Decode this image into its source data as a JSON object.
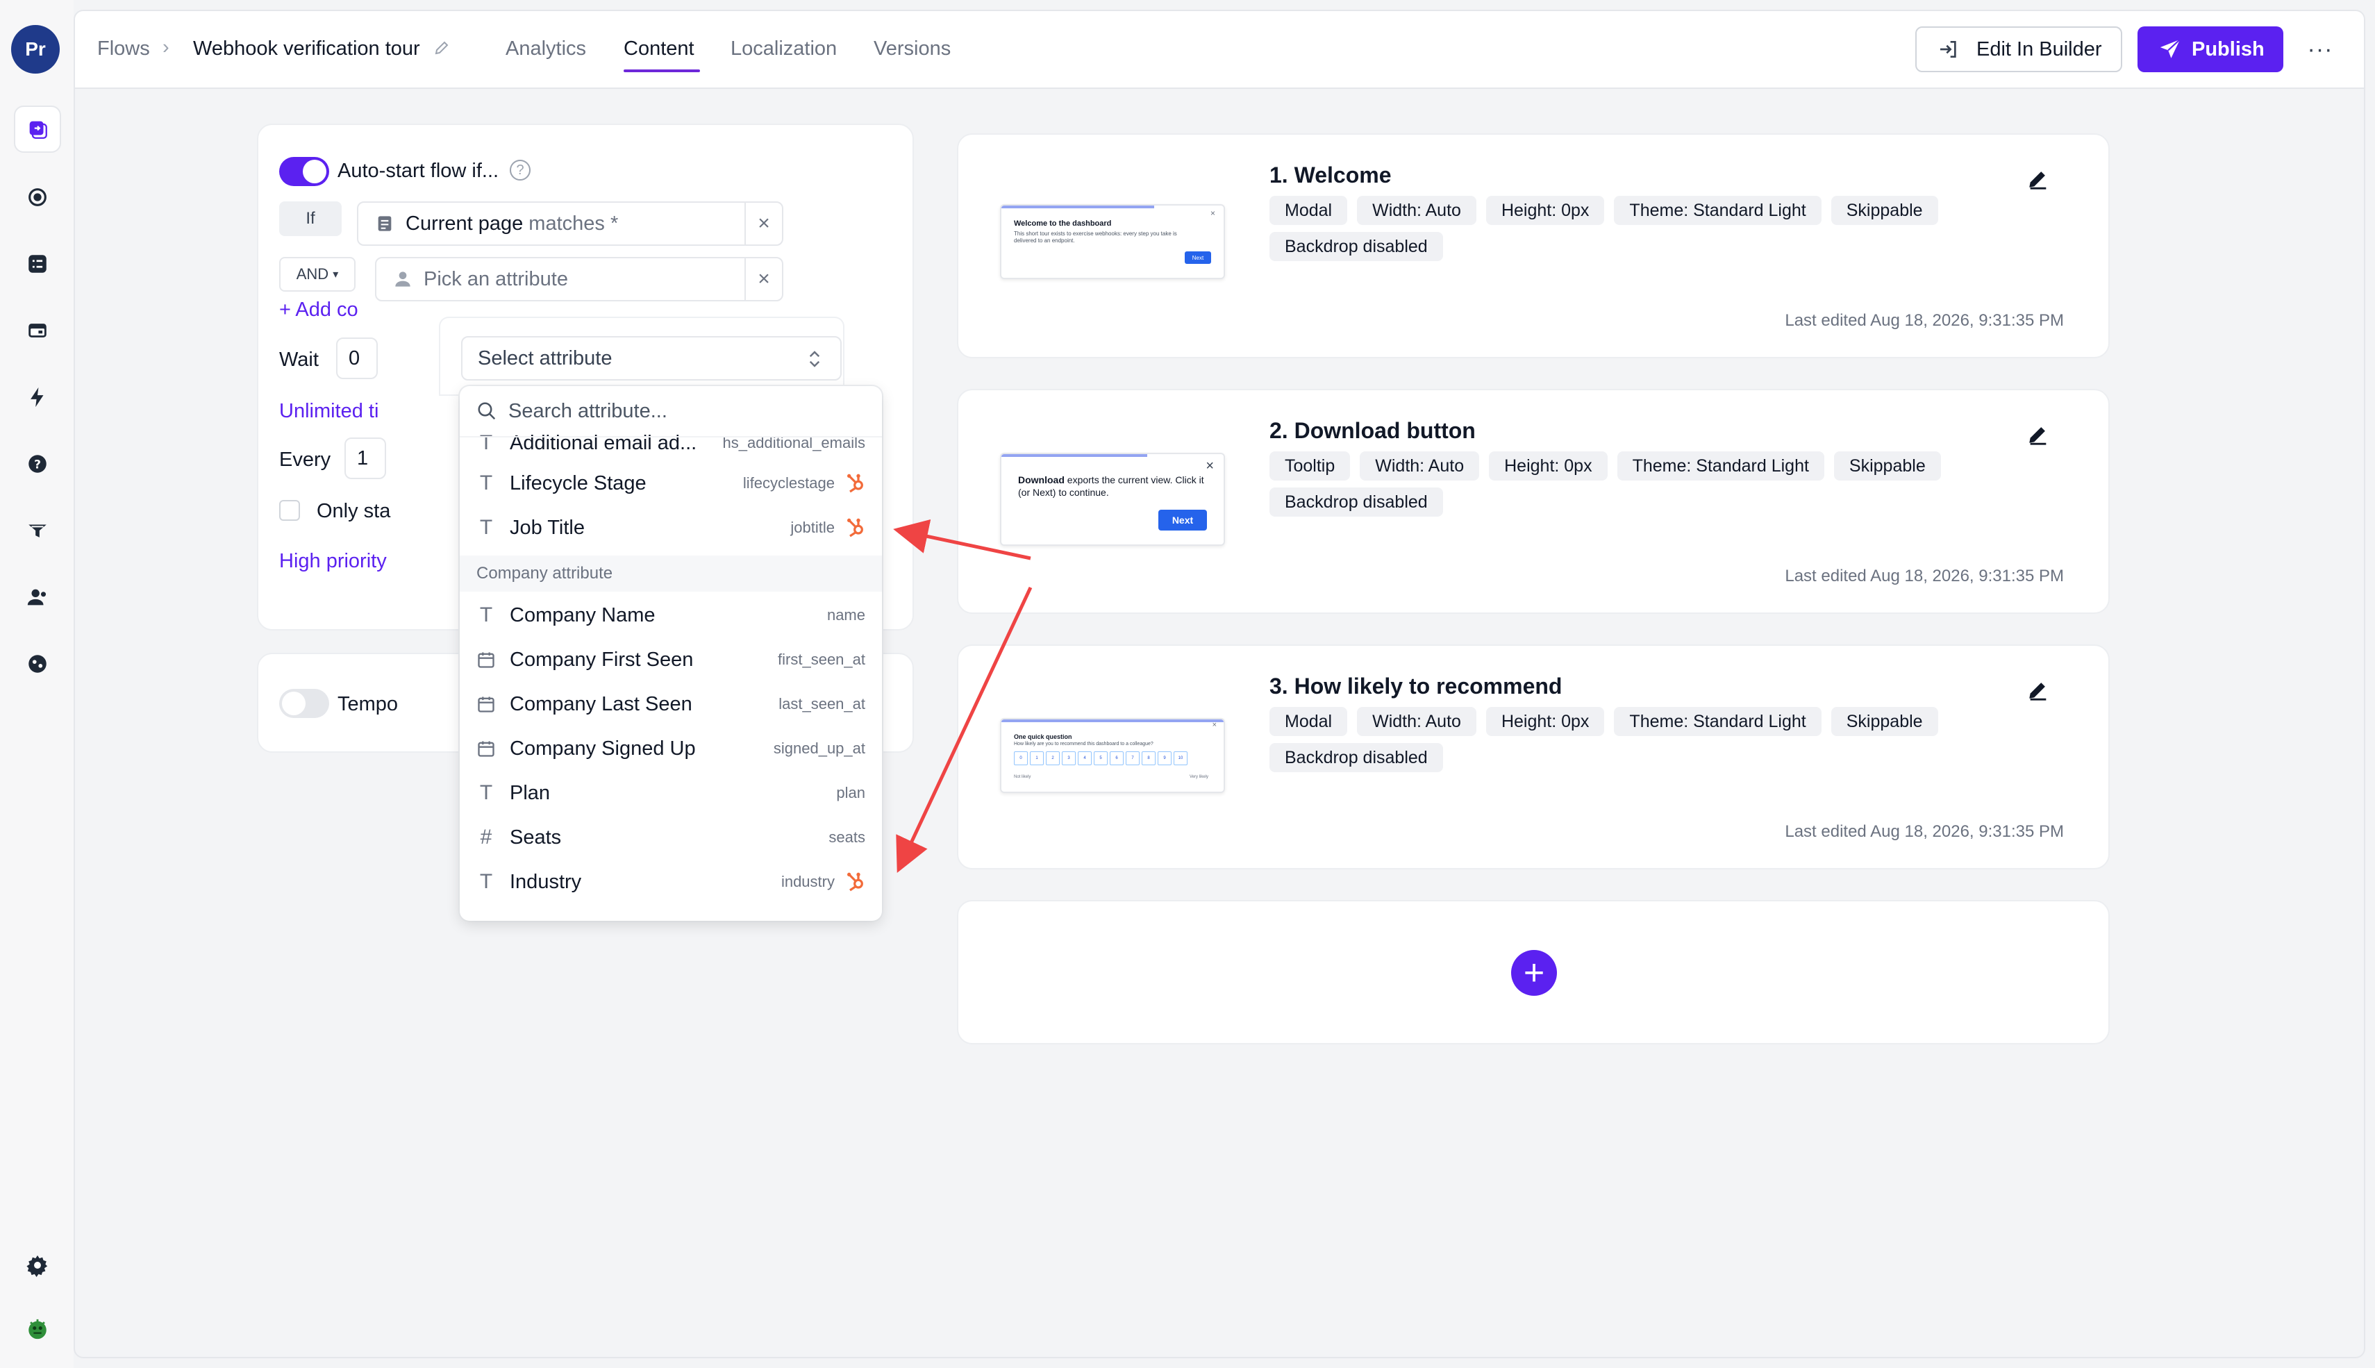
{
  "rail": {
    "avatar": "Pr"
  },
  "header": {
    "breadcrumb_root": "Flows",
    "breadcrumb_sep": "›",
    "flow_title": "Webhook verification tour",
    "tabs": [
      "Analytics",
      "Content",
      "Localization",
      "Versions"
    ],
    "active_tab": "Content",
    "edit_builder_label": "Edit In Builder",
    "publish_label": "Publish",
    "more_label": "···"
  },
  "rule_card": {
    "autostart_label": "Auto-start flow if...",
    "help": "?",
    "if_label": "If",
    "page_match_label": "Current page",
    "page_match_op": "matches *",
    "and_label": "AND",
    "pick_attribute_placeholder": "Pick an attribute",
    "clear_icon": "×",
    "add_condition": "+ Add co",
    "wait_label": "Wait",
    "wait_value": "0",
    "unlimited_link": "Unlimited ti",
    "every_label": "Every",
    "every_value": "1",
    "only_start_label": "Only sta",
    "high_priority_link": "High priority"
  },
  "temp_card": {
    "label": "Tempo"
  },
  "select": {
    "placeholder": "Select attribute",
    "search_placeholder": "Search attribute..."
  },
  "dropdown": {
    "user_items": [
      {
        "label": "Additional email ad...",
        "key": "hs_additional_emails",
        "type": "text",
        "hubspot": false
      },
      {
        "label": "Lifecycle Stage",
        "key": "lifecyclestage",
        "type": "text",
        "hubspot": true
      },
      {
        "label": "Job Title",
        "key": "jobtitle",
        "type": "text",
        "hubspot": true
      }
    ],
    "section_label": "Company attribute",
    "company_items": [
      {
        "label": "Company Name",
        "key": "name",
        "type": "text",
        "hubspot": false
      },
      {
        "label": "Company First Seen",
        "key": "first_seen_at",
        "type": "date",
        "hubspot": false
      },
      {
        "label": "Company Last Seen",
        "key": "last_seen_at",
        "type": "date",
        "hubspot": false
      },
      {
        "label": "Company Signed Up",
        "key": "signed_up_at",
        "type": "date",
        "hubspot": false
      },
      {
        "label": "Plan",
        "key": "plan",
        "type": "text",
        "hubspot": false
      },
      {
        "label": "Seats",
        "key": "seats",
        "type": "number",
        "hubspot": false
      },
      {
        "label": "Industry",
        "key": "industry",
        "type": "text",
        "hubspot": true
      }
    ],
    "type_glyphs": {
      "text": "T",
      "number": "#"
    }
  },
  "steps": [
    {
      "title": "1. Welcome",
      "tags": [
        "Modal",
        "Width: Auto",
        "Height: 0px",
        "Theme: Standard Light",
        "Skippable",
        "Backdrop disabled"
      ],
      "edited": "Last edited Aug 18, 2026, 9:31:35 PM",
      "thumb": {
        "heading": "Welcome to the dashboard",
        "body": "This short tour exists to exercise webhooks: every step you take is delivered to an endpoint.",
        "button": "Next",
        "close": "×"
      }
    },
    {
      "title": "2. Download button",
      "tags": [
        "Tooltip",
        "Width: Auto",
        "Height: 0px",
        "Theme: Standard Light",
        "Skippable",
        "Backdrop disabled"
      ],
      "edited": "Last edited Aug 18, 2026, 9:31:35 PM",
      "thumb": {
        "heading": "Download",
        "body": "exports the current view. Click it (or Next) to continue.",
        "button": "Next",
        "close": "×"
      }
    },
    {
      "title": "3. How likely to recommend",
      "tags": [
        "Modal",
        "Width: Auto",
        "Height: 0px",
        "Theme: Standard Light",
        "Skippable",
        "Backdrop disabled"
      ],
      "edited": "Last edited Aug 18, 2026, 9:31:35 PM",
      "thumb": {
        "heading": "One quick question",
        "body": "How likely are you to recommend this dashboard to a colleague?",
        "scale": [
          "0",
          "1",
          "2",
          "3",
          "4",
          "5",
          "6",
          "7",
          "8",
          "9",
          "10"
        ],
        "low": "Not likely",
        "high": "Very likely",
        "close": "×"
      }
    }
  ],
  "add_step": {
    "label": "+"
  },
  "colors": {
    "accent": "#5b21f0",
    "hubspot": "#f26b3a",
    "annotation_arrow": "#ef4444"
  }
}
